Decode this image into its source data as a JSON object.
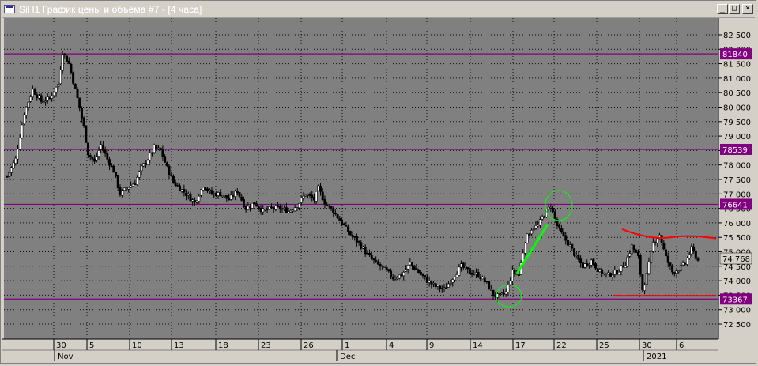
{
  "window": {
    "title": "SiH1 График цены и объёма #7 - [4 часа]",
    "btn_min": "_",
    "btn_max": "□",
    "btn_close": "×"
  },
  "colors": {
    "plot_bg": "#808080",
    "grid": "#000000",
    "level_line": "#800080",
    "candle": "#000000",
    "trend_line": "#00ff00",
    "circle": "#00ff00",
    "channel_line": "#ff0000",
    "axis_bg": "#c0c0c0"
  },
  "chart_data": {
    "type": "candlestick",
    "title": "",
    "ylim": [
      72200,
      82800
    ],
    "y_ticks": [
      72500,
      73000,
      73500,
      74000,
      74500,
      75000,
      75500,
      76000,
      76500,
      77000,
      77500,
      78000,
      78500,
      79000,
      79500,
      80000,
      80500,
      81000,
      81500,
      82000,
      82500
    ],
    "y_tick_labels": [
      "72 500",
      "73 000",
      "73 500",
      "74 000",
      "74 500",
      "75 000",
      "75 500",
      "76 000",
      "76 500",
      "77 000",
      "77 500",
      "78 000",
      "78 500",
      "79 000",
      "79 500",
      "80 000",
      "80 500",
      "81 000",
      "81 500",
      "82 000",
      "82 500"
    ],
    "levels": [
      {
        "value": 81840,
        "label": "81840"
      },
      {
        "value": 78539,
        "label": "78539"
      },
      {
        "value": 76641,
        "label": "76641"
      },
      {
        "value": 73367,
        "label": "73367"
      }
    ],
    "last_price_label": "74 768",
    "last_price": 74768,
    "x_day_labels": [
      "30",
      "5",
      "10",
      "13",
      "18",
      "23",
      "26",
      "1",
      "4",
      "9",
      "14",
      "17",
      "22",
      "25",
      "30",
      "6"
    ],
    "x_month_labels": [
      "Nov",
      "Dec",
      "2021"
    ],
    "close_path": [
      {
        "i": 0,
        "p": 77600
      },
      {
        "i": 4,
        "p": 78200
      },
      {
        "i": 8,
        "p": 79800
      },
      {
        "i": 12,
        "p": 80600
      },
      {
        "i": 16,
        "p": 80200
      },
      {
        "i": 20,
        "p": 80300
      },
      {
        "i": 24,
        "p": 80800
      },
      {
        "i": 26,
        "p": 81900
      },
      {
        "i": 29,
        "p": 81500
      },
      {
        "i": 33,
        "p": 80300
      },
      {
        "i": 36,
        "p": 79300
      },
      {
        "i": 38,
        "p": 78400
      },
      {
        "i": 41,
        "p": 78100
      },
      {
        "i": 44,
        "p": 78700
      },
      {
        "i": 47,
        "p": 78200
      },
      {
        "i": 50,
        "p": 77800
      },
      {
        "i": 53,
        "p": 77000
      },
      {
        "i": 56,
        "p": 77200
      },
      {
        "i": 60,
        "p": 77400
      },
      {
        "i": 63,
        "p": 77900
      },
      {
        "i": 66,
        "p": 78200
      },
      {
        "i": 69,
        "p": 78600
      },
      {
        "i": 72,
        "p": 78500
      },
      {
        "i": 75,
        "p": 77900
      },
      {
        "i": 78,
        "p": 77400
      },
      {
        "i": 81,
        "p": 77200
      },
      {
        "i": 84,
        "p": 77000
      },
      {
        "i": 88,
        "p": 76700
      },
      {
        "i": 92,
        "p": 77300
      },
      {
        "i": 96,
        "p": 77000
      },
      {
        "i": 100,
        "p": 77000
      },
      {
        "i": 104,
        "p": 76800
      },
      {
        "i": 108,
        "p": 77100
      },
      {
        "i": 112,
        "p": 76500
      },
      {
        "i": 116,
        "p": 76700
      },
      {
        "i": 120,
        "p": 76400
      },
      {
        "i": 124,
        "p": 76500
      },
      {
        "i": 128,
        "p": 76500
      },
      {
        "i": 132,
        "p": 76400
      },
      {
        "i": 136,
        "p": 76600
      },
      {
        "i": 140,
        "p": 77000
      },
      {
        "i": 144,
        "p": 76800
      },
      {
        "i": 146,
        "p": 77200
      },
      {
        "i": 149,
        "p": 76700
      },
      {
        "i": 153,
        "p": 76400
      },
      {
        "i": 157,
        "p": 76000
      },
      {
        "i": 161,
        "p": 75600
      },
      {
        "i": 165,
        "p": 75300
      },
      {
        "i": 169,
        "p": 74900
      },
      {
        "i": 173,
        "p": 74600
      },
      {
        "i": 177,
        "p": 74400
      },
      {
        "i": 181,
        "p": 74100
      },
      {
        "i": 185,
        "p": 74200
      },
      {
        "i": 189,
        "p": 74600
      },
      {
        "i": 193,
        "p": 74300
      },
      {
        "i": 197,
        "p": 74000
      },
      {
        "i": 201,
        "p": 73800
      },
      {
        "i": 205,
        "p": 73700
      },
      {
        "i": 209,
        "p": 74100
      },
      {
        "i": 213,
        "p": 74500
      },
      {
        "i": 217,
        "p": 74300
      },
      {
        "i": 221,
        "p": 74200
      },
      {
        "i": 225,
        "p": 73900
      },
      {
        "i": 228,
        "p": 73500
      },
      {
        "i": 231,
        "p": 73450
      },
      {
        "i": 234,
        "p": 73600
      },
      {
        "i": 237,
        "p": 74300
      },
      {
        "i": 240,
        "p": 74200
      },
      {
        "i": 243,
        "p": 75400
      },
      {
        "i": 246,
        "p": 75800
      },
      {
        "i": 249,
        "p": 75900
      },
      {
        "i": 252,
        "p": 76300
      },
      {
        "i": 255,
        "p": 76600
      },
      {
        "i": 258,
        "p": 75900
      },
      {
        "i": 261,
        "p": 75500
      },
      {
        "i": 264,
        "p": 75200
      },
      {
        "i": 267,
        "p": 74800
      },
      {
        "i": 270,
        "p": 74500
      },
      {
        "i": 274,
        "p": 74700
      },
      {
        "i": 278,
        "p": 74300
      },
      {
        "i": 282,
        "p": 74200
      },
      {
        "i": 286,
        "p": 74300
      },
      {
        "i": 290,
        "p": 74600
      },
      {
        "i": 293,
        "p": 75200
      },
      {
        "i": 296,
        "p": 74800
      },
      {
        "i": 298,
        "p": 73700
      },
      {
        "i": 300,
        "p": 74200
      },
      {
        "i": 303,
        "p": 75300
      },
      {
        "i": 306,
        "p": 75600
      },
      {
        "i": 309,
        "p": 74800
      },
      {
        "i": 312,
        "p": 74300
      },
      {
        "i": 315,
        "p": 74400
      },
      {
        "i": 318,
        "p": 74600
      },
      {
        "i": 321,
        "p": 75100
      },
      {
        "i": 324,
        "p": 74700
      }
    ]
  }
}
